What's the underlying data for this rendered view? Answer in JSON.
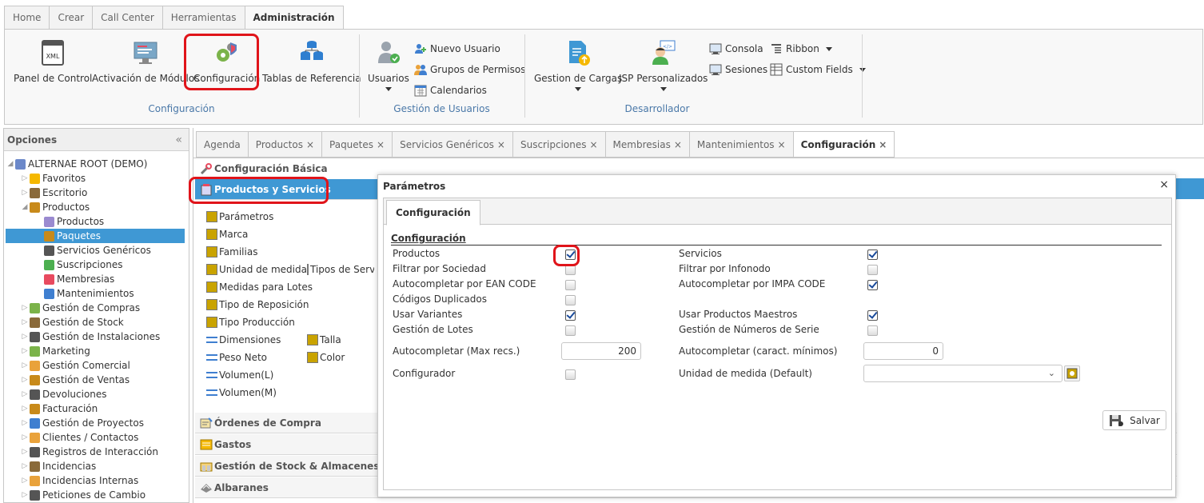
{
  "ribbon_tabs": [
    "Home",
    "Crear",
    "Call Center",
    "Herramientas",
    "Administración"
  ],
  "ribbon": {
    "configuracion_group": {
      "label": "Configuración",
      "buttons": [
        "Panel de Control",
        "Activación de Módulos",
        "Configuración",
        "Tablas de Referencia"
      ]
    },
    "usuarios_group": {
      "label": "Gestión de Usuarios",
      "usuarios": "Usuarios",
      "nuevo_usuario": "Nuevo Usuario",
      "grupos_permisos": "Grupos de Permisos",
      "calendarios": "Calendarios"
    },
    "desarrollador_group": {
      "label": "Desarrollador",
      "gestion_cargas": "Gestion de Cargas",
      "jsp": "JSP Personalizados",
      "consola": "Consola",
      "sesiones": "Sesiones",
      "ribbon": "Ribbon",
      "custom_fields": "Custom Fields"
    }
  },
  "left_panel": {
    "title": "Opciones",
    "collapse_glyph": "«",
    "tree": [
      "ALTERNAE ROOT (DEMO)",
      "Favoritos",
      "Escritorio",
      "Productos",
      "Productos",
      "Paquetes",
      "Servicios Genéricos",
      "Suscripciones",
      "Membresias",
      "Mantenimientos",
      "Gestión de Compras",
      "Gestión de Stock",
      "Gestión de Instalaciones",
      "Marketing",
      "Gestión Comercial",
      "Gestión de Ventas",
      "Devoluciones",
      "Facturación",
      "Gestión de Proyectos",
      "Clientes / Contactos",
      "Registros de Interacción",
      "Incidencias",
      "Incidencias Internas",
      "Peticiones de Cambio"
    ]
  },
  "doc_tabs": [
    "Agenda",
    "Productos",
    "Paquetes",
    "Servicios Genéricos",
    "Suscripciones",
    "Membresias",
    "Mantenimientos",
    "Configuración"
  ],
  "close_glyph": "×",
  "accordion": {
    "config_basica": "Configuración Básica",
    "productos_servicios": "Productos y Servicios",
    "ordenes_compra": "Órdenes de Compra",
    "gastos": "Gastos",
    "gestion_stock": "Gestión de Stock & Almacenes",
    "albaranes": "Albaranes"
  },
  "ps_items": [
    "Parámetros",
    "Marca",
    "Familias",
    "Unidad de medida",
    "Tipos de Servi",
    "Medidas para Lotes",
    "Tipo de Reposición",
    "Tipo Producción",
    "Dimensiones",
    "Talla",
    "Peso Neto",
    "Color",
    "Volumen(L)",
    "Volumen(M)"
  ],
  "dialog": {
    "title": "Parámetros",
    "close": "×",
    "tab": "Configuración",
    "legend": "Configuración",
    "left_fields": [
      {
        "label": "Productos",
        "checked": true
      },
      {
        "label": "Filtrar por Sociedad",
        "checked": false
      },
      {
        "label": "Autocompletar por EAN CODE",
        "checked": false
      },
      {
        "label": "Códigos Duplicados",
        "checked": false
      },
      {
        "label": "Usar Variantes",
        "checked": true
      },
      {
        "label": "Gestión de Lotes",
        "checked": false
      }
    ],
    "right_fields": [
      {
        "label": "Servicios",
        "checked": true
      },
      {
        "label": "Filtrar por Infonodo",
        "checked": false
      },
      {
        "label": "Autocompletar por IMPA CODE",
        "checked": true
      },
      {
        "label": "Usar Productos Maestros",
        "checked": true
      },
      {
        "label": "Gestión de Números de Serie",
        "checked": false
      }
    ],
    "autocompletar_max_label": "Autocompletar (Max recs.)",
    "autocompletar_max_value": "200",
    "autocompletar_min_label": "Autocompletar (caract. mínimos)",
    "autocompletar_min_value": "0",
    "configurador_label": "Configurador",
    "configurador_checked": false,
    "unidad_label": "Unidad de medida (Default)",
    "unidad_value": "",
    "save_label": "Salvar"
  }
}
